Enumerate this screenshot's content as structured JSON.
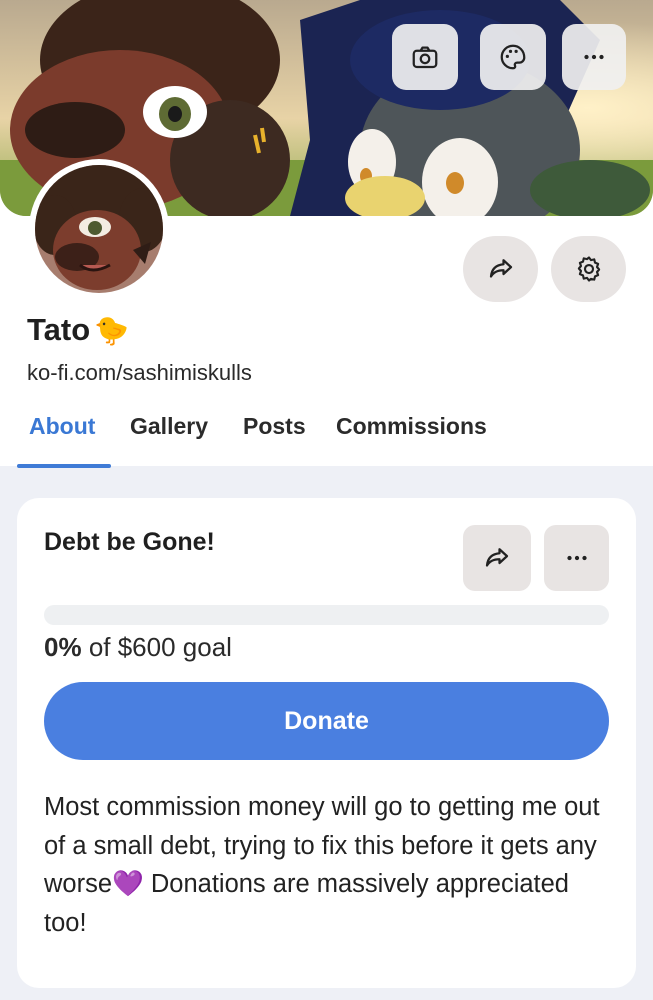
{
  "profile": {
    "name": "Tato",
    "name_emoji": "🐤",
    "url": "ko-fi.com/sashimiskulls"
  },
  "tabs": [
    {
      "label": "About",
      "active": true
    },
    {
      "label": "Gallery",
      "active": false
    },
    {
      "label": "Posts",
      "active": false
    },
    {
      "label": "Commissions",
      "active": false
    }
  ],
  "banner_buttons": [
    "camera-icon",
    "palette-icon",
    "more-icon"
  ],
  "profile_buttons": [
    "share-icon",
    "gear-icon"
  ],
  "goal": {
    "title": "Debt be Gone!",
    "progress_fraction": 0.0,
    "percent_text": "0%",
    "goal_text": "of $600 goal",
    "donate_label": "Donate",
    "description": "Most commission money will go to getting me out of a small debt, trying to fix this before it gets any worse💜 Donations are massively appreciated too!"
  },
  "colors": {
    "accent": "#3f7bd6",
    "donate_button": "#4a7fe0",
    "button_bg": "#e8e4e3",
    "page_bg": "#eef0f6"
  }
}
